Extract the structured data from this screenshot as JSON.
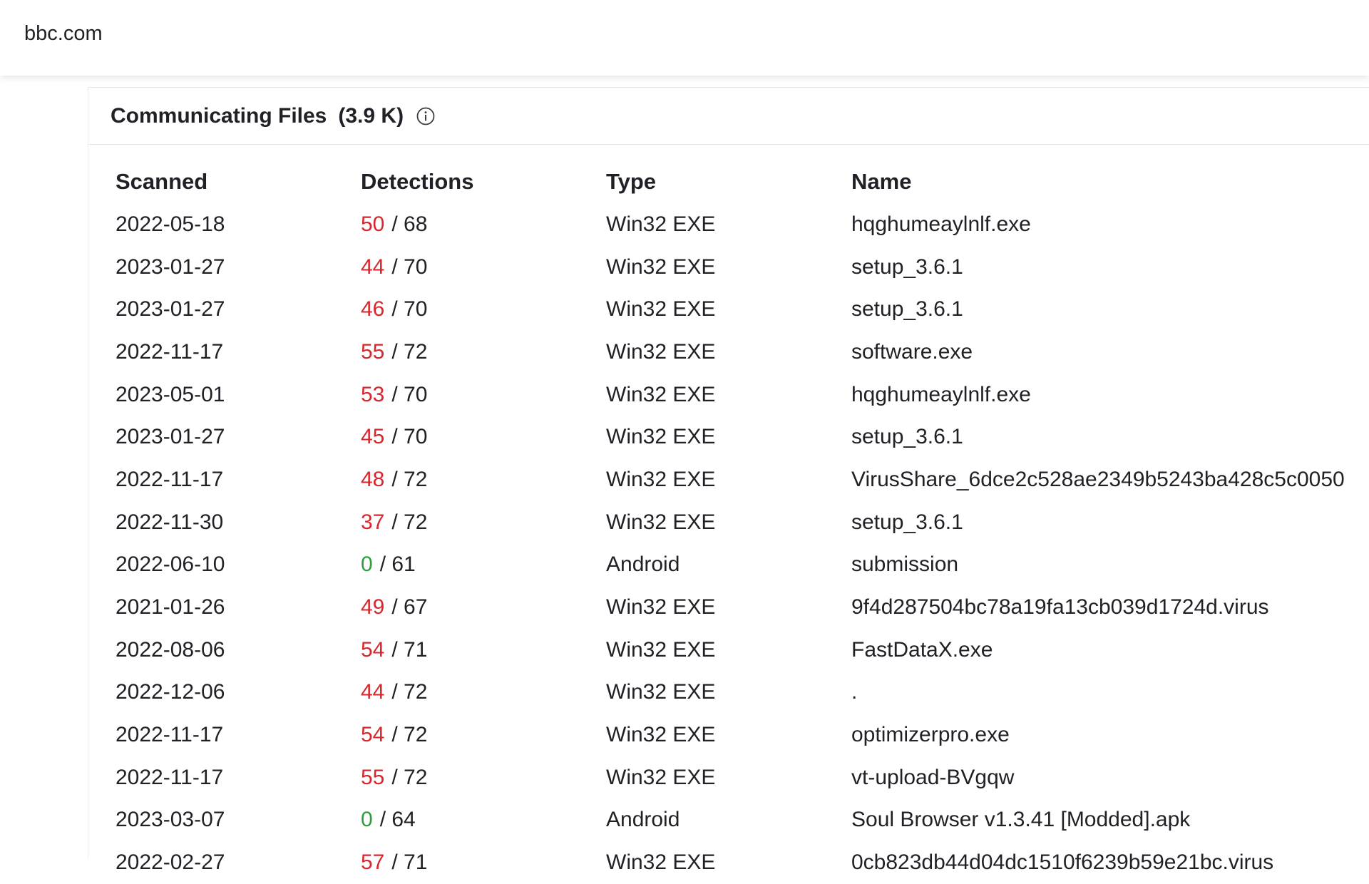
{
  "header": {
    "domain": "bbc.com"
  },
  "section": {
    "title": "Communicating Files",
    "count": "(3.9 K)",
    "info_icon": "info-circle-icon"
  },
  "table": {
    "columns": [
      "Scanned",
      "Detections",
      "Type",
      "Name"
    ],
    "rows": [
      {
        "scanned": "2022-05-18",
        "positives": "50",
        "total": "/ 68",
        "type": "Win32 EXE",
        "name": "hqghumeaylnlf.exe",
        "status": "malicious"
      },
      {
        "scanned": "2023-01-27",
        "positives": "44",
        "total": "/ 70",
        "type": "Win32 EXE",
        "name": "setup_3.6.1",
        "status": "malicious"
      },
      {
        "scanned": "2023-01-27",
        "positives": "46",
        "total": "/ 70",
        "type": "Win32 EXE",
        "name": "setup_3.6.1",
        "status": "malicious"
      },
      {
        "scanned": "2022-11-17",
        "positives": "55",
        "total": "/ 72",
        "type": "Win32 EXE",
        "name": "software.exe",
        "status": "malicious"
      },
      {
        "scanned": "2023-05-01",
        "positives": "53",
        "total": "/ 70",
        "type": "Win32 EXE",
        "name": "hqghumeaylnlf.exe",
        "status": "malicious"
      },
      {
        "scanned": "2023-01-27",
        "positives": "45",
        "total": "/ 70",
        "type": "Win32 EXE",
        "name": "setup_3.6.1",
        "status": "malicious"
      },
      {
        "scanned": "2022-11-17",
        "positives": "48",
        "total": "/ 72",
        "type": "Win32 EXE",
        "name": "VirusShare_6dce2c528ae2349b5243ba428c5c0050",
        "status": "malicious"
      },
      {
        "scanned": "2022-11-30",
        "positives": "37",
        "total": "/ 72",
        "type": "Win32 EXE",
        "name": "setup_3.6.1",
        "status": "malicious"
      },
      {
        "scanned": "2022-06-10",
        "positives": "0",
        "total": "/ 61",
        "type": "Android",
        "name": "submission",
        "status": "clean"
      },
      {
        "scanned": "2021-01-26",
        "positives": "49",
        "total": "/ 67",
        "type": "Win32 EXE",
        "name": "9f4d287504bc78a19fa13cb039d1724d.virus",
        "status": "malicious"
      },
      {
        "scanned": "2022-08-06",
        "positives": "54",
        "total": "/ 71",
        "type": "Win32 EXE",
        "name": "FastDataX.exe",
        "status": "malicious"
      },
      {
        "scanned": "2022-12-06",
        "positives": "44",
        "total": "/ 72",
        "type": "Win32 EXE",
        "name": ".",
        "status": "malicious"
      },
      {
        "scanned": "2022-11-17",
        "positives": "54",
        "total": "/ 72",
        "type": "Win32 EXE",
        "name": "optimizerpro.exe",
        "status": "malicious"
      },
      {
        "scanned": "2022-11-17",
        "positives": "55",
        "total": "/ 72",
        "type": "Win32 EXE",
        "name": "vt-upload-BVgqw",
        "status": "malicious"
      },
      {
        "scanned": "2023-03-07",
        "positives": "0",
        "total": "/ 64",
        "type": "Android",
        "name": "Soul Browser v1.3.41 [Modded].apk",
        "status": "clean"
      },
      {
        "scanned": "2022-02-27",
        "positives": "57",
        "total": "/ 71",
        "type": "Win32 EXE",
        "name": "0cb823db44d04dc1510f6239b59e21bc.virus",
        "status": "malicious"
      }
    ]
  },
  "colors": {
    "malicious": "#d8262c",
    "clean": "#2e9e3d"
  }
}
